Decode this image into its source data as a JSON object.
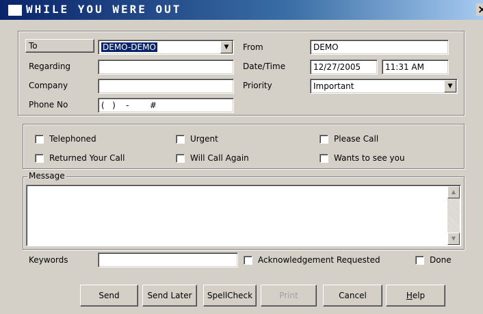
{
  "window": {
    "title": "WHILE YOU WERE OUT",
    "close_glyph": "✕"
  },
  "header": {
    "to_button": "To",
    "to_value": "DEMO-DEMO",
    "regarding_label": "Regarding",
    "regarding_value": "",
    "company_label": "Company",
    "company_value": "",
    "phone_label": "Phone No",
    "phone_value": "(   )    -        #",
    "from_label": "From",
    "from_value": "DEMO",
    "datetime_label": "Date/Time",
    "date_value": "12/27/2005",
    "time_value": "11:31 AM",
    "priority_label": "Priority",
    "priority_value": "Important"
  },
  "flags": {
    "telephoned": "Telephoned",
    "urgent": "Urgent",
    "please_call": "Please Call",
    "returned_call": "Returned Your Call",
    "will_call_again": "Will Call Again",
    "wants_to_see": "Wants to see you"
  },
  "message": {
    "legend": "Message",
    "value": ""
  },
  "footer": {
    "keywords_label": "Keywords",
    "keywords_value": "",
    "ack_label": "Acknowledgement Requested",
    "done_label": "Done"
  },
  "buttons": {
    "send": "Send",
    "send_later": "Send Later",
    "spellcheck": "SpellCheck",
    "print": "Print",
    "cancel": "Cancel",
    "help_first": "H",
    "help_rest": "elp"
  },
  "icons": {
    "dropdown": "chevron-down-icon",
    "scroll_up": "arrow-up-icon",
    "scroll_down": "arrow-down-icon"
  },
  "colors": {
    "titlebar": "#0a246a",
    "face": "#d4d0c8",
    "selection": "#0a246a"
  }
}
